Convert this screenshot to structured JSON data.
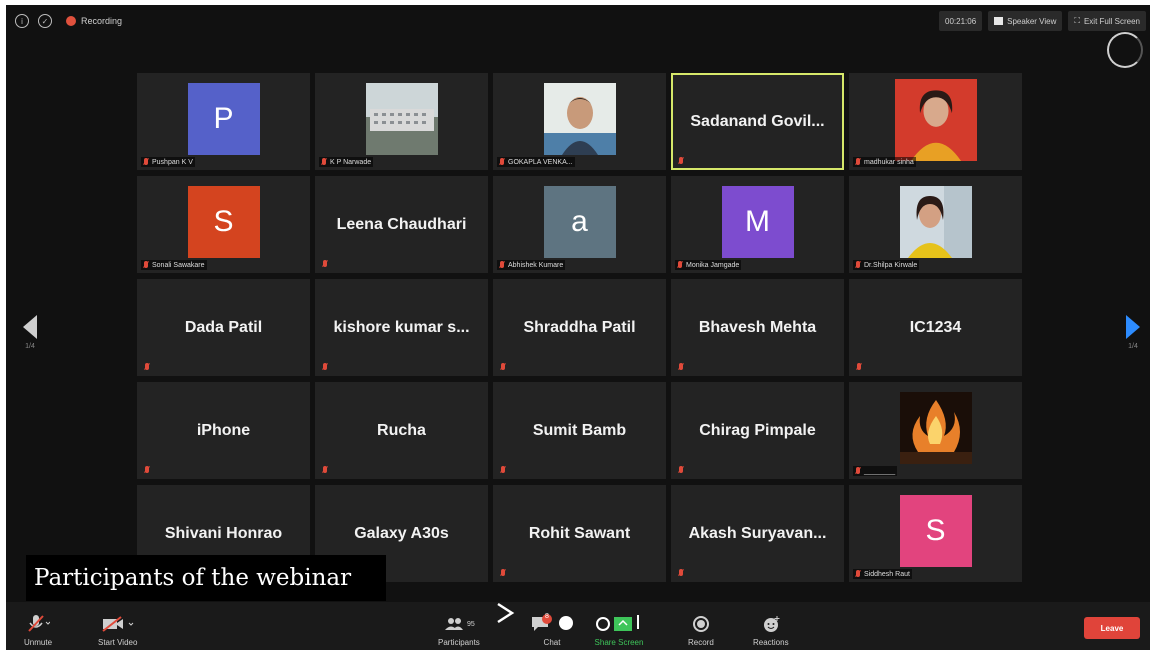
{
  "topbar": {
    "recording_label": "Recording",
    "timer": "00:21:06",
    "speaker_view_label": "Speaker View",
    "exit_fullscreen_label": "Exit Full Screen"
  },
  "pagination": {
    "left": "1/4",
    "right": "1/4"
  },
  "tiles": [
    {
      "kind": "avatar",
      "letter": "P",
      "color": "#5561c9",
      "label": "Pushpan K V"
    },
    {
      "kind": "photo",
      "photo": "building",
      "label": "K P Narwade"
    },
    {
      "kind": "photo",
      "photo": "man",
      "label": "GOKAPLA VENKA..."
    },
    {
      "kind": "name",
      "name": "Sadanand  Govil...",
      "active": true
    },
    {
      "kind": "photo",
      "photo": "woman-red",
      "label": "madhukar sinha"
    },
    {
      "kind": "avatar",
      "letter": "S",
      "color": "#d4441f",
      "label": "Sonali Sawakare"
    },
    {
      "kind": "name",
      "name": "Leena Chaudhari"
    },
    {
      "kind": "avatar",
      "letter": "a",
      "color": "#5e7481",
      "label": "Abhishek Kumare"
    },
    {
      "kind": "avatar",
      "letter": "M",
      "color": "#7d4ccf",
      "label": "Monika Jamgade"
    },
    {
      "kind": "photo",
      "photo": "woman-yellow",
      "label": "Dr.Shilpa Kirwale"
    },
    {
      "kind": "name",
      "name": "Dada Patil"
    },
    {
      "kind": "name",
      "name": "kishore kumar s..."
    },
    {
      "kind": "name",
      "name": "Shraddha Patil"
    },
    {
      "kind": "name",
      "name": "Bhavesh Mehta"
    },
    {
      "kind": "name",
      "name": "IC1234"
    },
    {
      "kind": "name",
      "name": "iPhone"
    },
    {
      "kind": "name",
      "name": "Rucha"
    },
    {
      "kind": "name",
      "name": "Sumit Bamb"
    },
    {
      "kind": "name",
      "name": "Chirag Pimpale"
    },
    {
      "kind": "photo",
      "photo": "fire",
      "label": "________"
    },
    {
      "kind": "name",
      "name": "Shivani Honrao"
    },
    {
      "kind": "name",
      "name": "Galaxy A30s"
    },
    {
      "kind": "name",
      "name": "Rohit Sawant"
    },
    {
      "kind": "name",
      "name": "Akash  Suryavan..."
    },
    {
      "kind": "avatar",
      "letter": "S",
      "color": "#e2447e",
      "label": "Siddhesh Raut"
    }
  ],
  "toolbar": {
    "unmute": "Unmute",
    "start_video": "Start Video",
    "participants": "Participants",
    "participants_count": "95",
    "chat": "Chat",
    "chat_badge": "8",
    "share_screen": "Share Screen",
    "record": "Record",
    "reactions": "Reactions",
    "leave": "Leave"
  },
  "caption": "Participants of the webinar"
}
